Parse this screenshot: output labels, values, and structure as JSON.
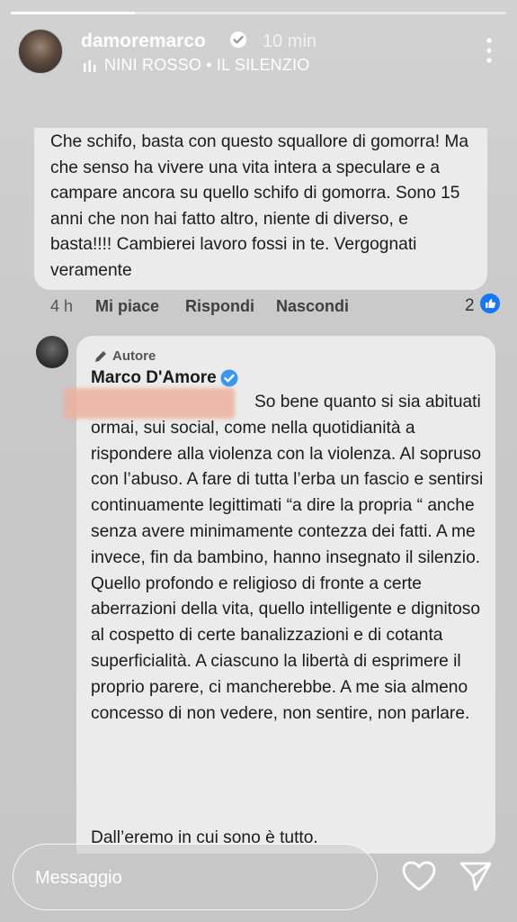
{
  "story": {
    "progress_fraction": 0.25,
    "username": "damoremarco",
    "posted_time": "10 min",
    "music": "NINI ROSSO  •  IL SILENZIO",
    "icons": [
      "verified-icon",
      "music-bars-icon",
      "more-options-icon"
    ]
  },
  "comment": {
    "text": "Che schifo, basta con questo squallore di gomorra! Ma che senso ha vivere una vita intera a speculare e a campare ancora su quello schifo di gomorra. Sono 15 anni che non hai fatto altro, niente di diverso, e basta!!!! Cambierei lavoro fossi in te. Vergognati veramente",
    "time": "4 h",
    "like_label": "Mi piace",
    "reply_label": "Rispondi",
    "hide_label": "Nascondi",
    "like_count": "2"
  },
  "reply": {
    "author_tag": "Autore",
    "name": "Marco D'Amore",
    "text": "So bene quanto si sia abituati ormai, sui social, come nella quotidianità a rispondere alla violenza con la violenza. Al sopruso con l’abuso. A fare di tutta l’erba un fascio e sentirsi continuamente legittimati “a dire la propria “ anche senza avere minimamente contezza dei fatti. A me invece, fin da bambino, hanno insegnato il silenzio. Quello profondo e religioso di fronte a certe aberrazioni della vita, quello intelligente e dignitoso al cospetto di certe banalizzazioni e di cotanta superficialità. A ciascuno la libertà di esprimere il proprio parere, ci mancherebbe. A me sia almeno concesso di non vedere, non sentire, non parlare.",
    "closing": "Dall’eremo in cui sono è tutto."
  },
  "footer": {
    "message_placeholder": "Messaggio"
  },
  "colors": {
    "verified": "#3897f0",
    "like_badge": "#1877f2",
    "redaction": "#ecb09e"
  }
}
